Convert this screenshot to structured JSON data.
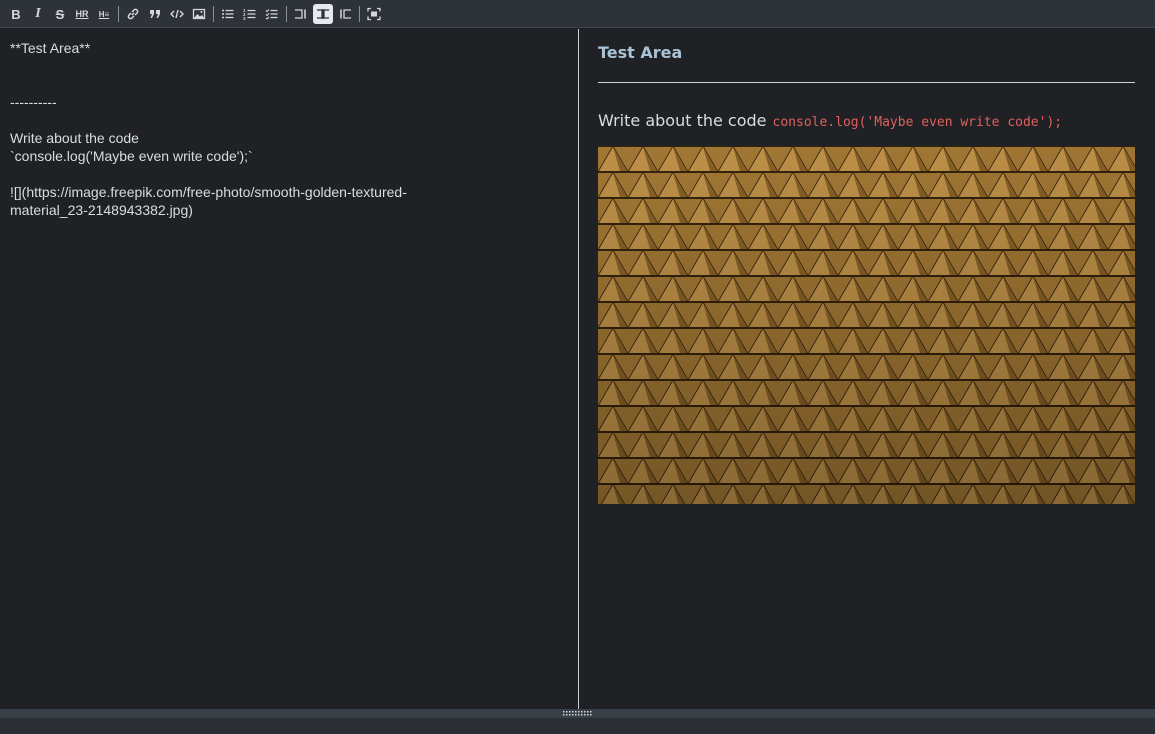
{
  "toolbar": {
    "buttons": [
      {
        "name": "bold-button",
        "icon": "bold-icon",
        "glyph": "B"
      },
      {
        "name": "italic-button",
        "icon": "italic-icon",
        "glyph": "I"
      },
      {
        "name": "strikethrough-button",
        "icon": "strikethrough-icon",
        "glyph": "S"
      },
      {
        "name": "horizontal-rule-button",
        "icon": "hr-icon",
        "glyph": "HR"
      },
      {
        "name": "heading-button",
        "icon": "heading-icon",
        "glyph": "H"
      },
      {
        "name": "link-button",
        "icon": "link-icon",
        "glyph": "link"
      },
      {
        "name": "quote-button",
        "icon": "quote-icon",
        "glyph": "quote"
      },
      {
        "name": "code-button",
        "icon": "code-icon",
        "glyph": "code"
      },
      {
        "name": "image-button",
        "icon": "image-icon",
        "glyph": "image"
      },
      {
        "name": "unordered-list-button",
        "icon": "unordered-list-icon",
        "glyph": "ul"
      },
      {
        "name": "ordered-list-button",
        "icon": "ordered-list-icon",
        "glyph": "ol"
      },
      {
        "name": "task-list-button",
        "icon": "task-list-icon",
        "glyph": "tl"
      },
      {
        "name": "edit-only-button",
        "icon": "edit-mode-icon",
        "glyph": "edit"
      },
      {
        "name": "split-view-button",
        "icon": "split-view-icon",
        "glyph": "split",
        "active": true
      },
      {
        "name": "preview-only-button",
        "icon": "preview-mode-icon",
        "glyph": "preview"
      },
      {
        "name": "fullscreen-button",
        "icon": "fullscreen-icon",
        "glyph": "full"
      }
    ]
  },
  "editor": {
    "lines": [
      "**Test Area**",
      "",
      "",
      "----------",
      "",
      "Write about the code",
      "`console.log('Maybe even write code');`",
      "",
      "![](https://image.freepik.com/free-photo/smooth-golden-textured-",
      "material_23-2148943382.jpg)"
    ]
  },
  "preview": {
    "title": "Test Area",
    "paragraph": "Write about the code",
    "code": "console.log('Maybe even write code');"
  },
  "colors": {
    "background": "#202124",
    "toolbar": "#2e333a",
    "title": "#a9c2d6",
    "code": "#e0605c",
    "gold": "#c9a052"
  }
}
